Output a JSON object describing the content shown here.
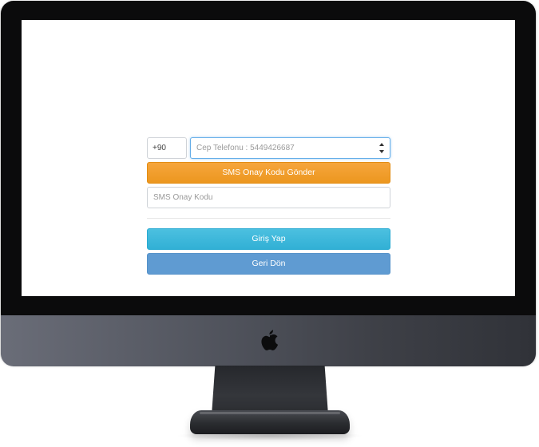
{
  "form": {
    "country_code": "+90",
    "phone_placeholder": "Cep Telefonu : 5449426687",
    "sms_button_label": "SMS Onay Kodu Gönder",
    "sms_code_placeholder": "SMS Onay Kodu",
    "login_button_label": "Giriş Yap",
    "back_button_label": "Geri Dön"
  },
  "icons": {
    "logo": "apple-logo-icon",
    "spinner_up": "chevron-up-icon",
    "spinner_down": "chevron-down-icon"
  },
  "colors": {
    "sms_button": "#ec971f",
    "login_button": "#31b0d5",
    "back_button": "#5f9bd2",
    "focus_border": "#66afe9"
  }
}
